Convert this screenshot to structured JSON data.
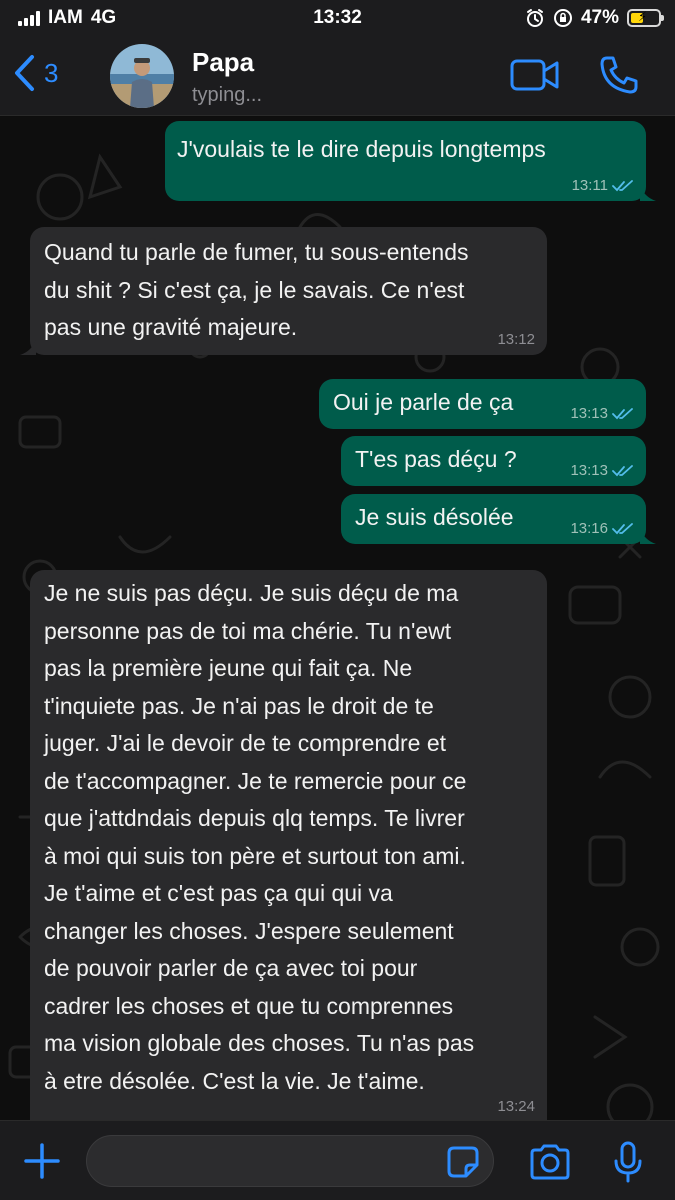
{
  "status_bar": {
    "carrier": "IAM",
    "network": "4G",
    "time": "13:32",
    "battery": "47%"
  },
  "header": {
    "back_count": "3",
    "contact_name": "Papa",
    "contact_status": "typing..."
  },
  "messages": [
    {
      "dir": "out",
      "text": "J'voulais te le dire depuis longtemps",
      "time": "13:11",
      "read": true
    },
    {
      "dir": "in",
      "text": "Quand tu parle de fumer, tu sous-entends\ndu shit ? Si c'est ça, je le savais. Ce n'est\npas une gravité majeure.",
      "time": "13:12"
    },
    {
      "dir": "out",
      "text": "Oui je parle de ça",
      "time": "13:13",
      "read": true
    },
    {
      "dir": "out",
      "text": "T'es pas déçu ?",
      "time": "13:13",
      "read": true
    },
    {
      "dir": "out",
      "text": "Je suis désolée",
      "time": "13:16",
      "read": true
    },
    {
      "dir": "in",
      "text": "Je ne suis pas déçu. Je suis déçu de ma\npersonne pas de toi ma chérie. Tu n'ewt\npas la première jeune qui fait ça. Ne\nt'inquiete pas. Je n'ai pas le droit de te\njuger. J'ai le devoir de te comprendre et\nde t'accompagner. Je te remercie pour ce\nque j'attdndais depuis qlq temps. Te livrer\nà moi qui suis ton père et surtout ton ami.\nJe t'aime et c'est pas ça qui qui va\nchanger les choses. J'espere seulement\nde pouvoir parler de ça avec toi pour\ncadrer les choses et que tu comprennes\nma vision globale des choses. Tu n'as pas\nà etre désolée. C'est la vie. Je t'aime.",
      "time": "13:24"
    }
  ],
  "composer": {
    "input_value": ""
  },
  "colors": {
    "accent": "#2d8cff",
    "outgoing_bubble": "#005c4b",
    "incoming_bubble": "#2a2a2c",
    "read_ticks": "#53bdeb"
  }
}
